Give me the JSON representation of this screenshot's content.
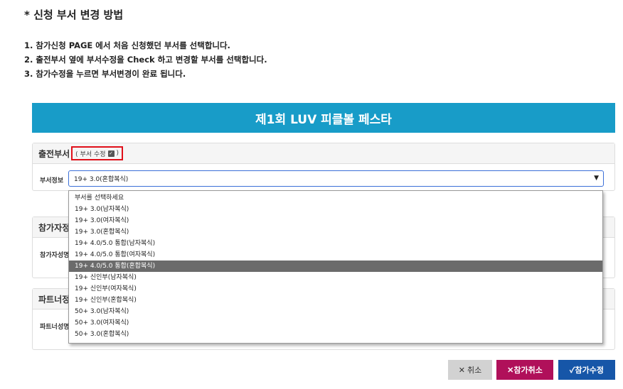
{
  "heading": "* 신청 부서 변경 방법",
  "steps": [
    "1. 참가신청 PAGE 에서 처음 신청했던 부서를 선택합니다.",
    "2. 출전부서 옆에 부서수정을 Check 하고 변경할 부서를 선택합니다.",
    "3. 참가수정을 누르면 부서변경이 완료 됩니다."
  ],
  "banner_title": "제1회 LUV 피클볼 페스타",
  "division_panel": {
    "title": "출전부서",
    "edit_label": "( 부서 수정",
    "edit_close": ")",
    "field_label": "부서정보",
    "selected_value": "19+ 3.0(혼합복식)"
  },
  "participant_panel": {
    "title": "참가자정",
    "field_label": "참가자성명"
  },
  "partner_panel": {
    "title": "파트너정",
    "field_label": "파트너성명"
  },
  "dropdown_options": [
    "부서를 선택하세요",
    "19+ 3.0(남자복식)",
    "19+ 3.0(여자복식)",
    "19+ 3.0(혼합복식)",
    "19+ 4.0/5.0 통합(남자복식)",
    "19+ 4.0/5.0 통합(여자복식)",
    "19+ 4.0/5.0 통합(혼합복식)",
    "19+ 신인부(남자복식)",
    "19+ 신인부(여자복식)",
    "19+ 신인부(혼합복식)",
    "50+ 3.0(남자복식)",
    "50+ 3.0(여자복식)",
    "50+ 3.0(혼합복식)"
  ],
  "highlighted_option_index": 6,
  "buttons": {
    "cancel": "✕ 취소",
    "withdraw": "✕참가취소",
    "modify": "✓참가수정"
  },
  "colors": {
    "banner": "#189cc8",
    "withdraw": "#b0105a",
    "modify": "#1656a8",
    "highlight_box": "#e0101a"
  }
}
